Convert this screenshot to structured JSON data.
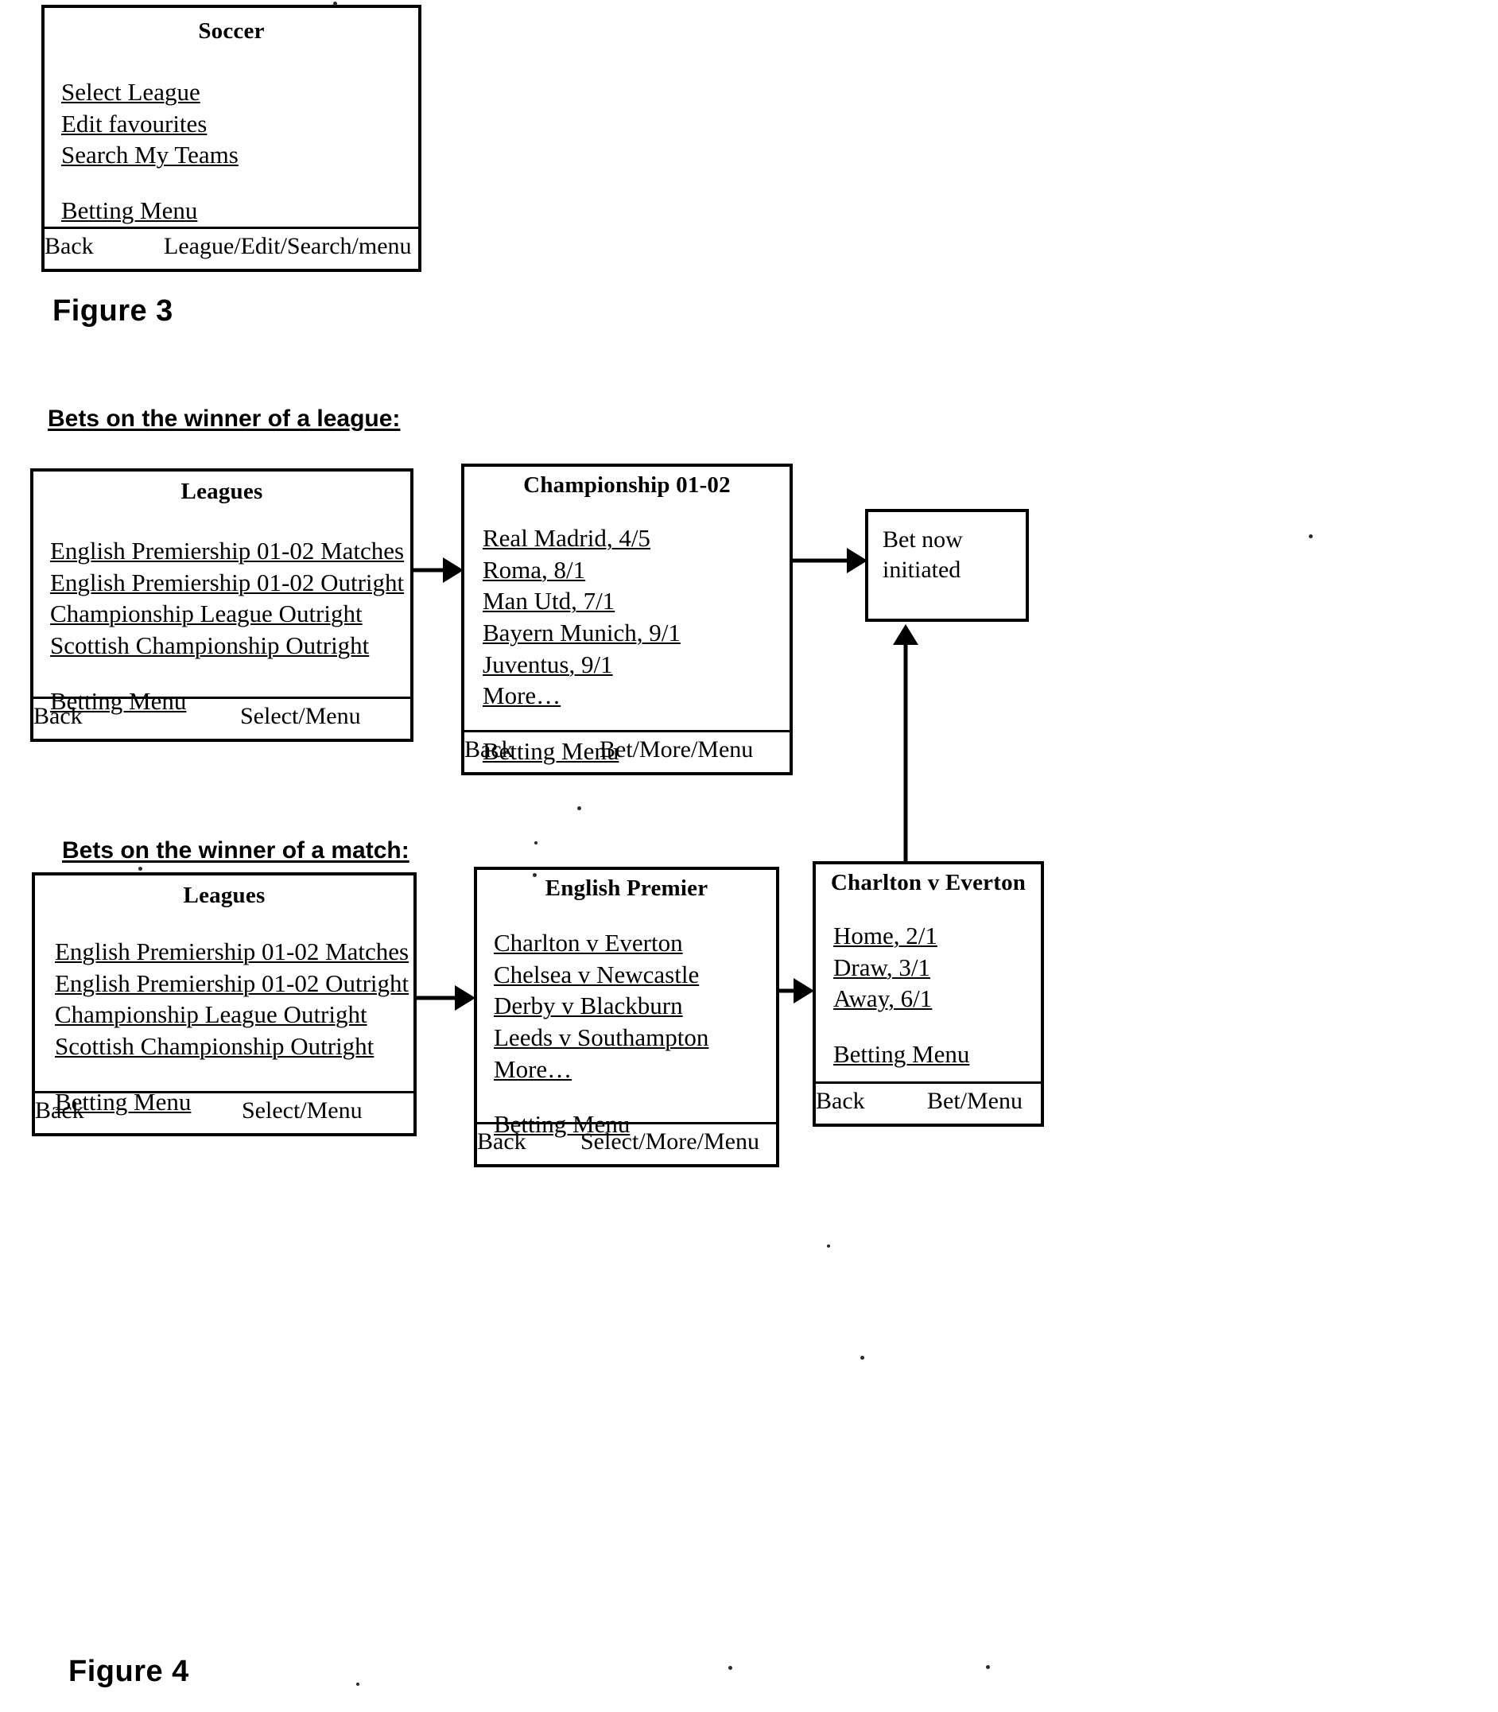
{
  "figure3": {
    "caption": "Figure 3",
    "screen": {
      "title": "Soccer",
      "items": [
        "Select League",
        "Edit favourites",
        "Search My Teams"
      ],
      "secondary": [
        "Betting Menu"
      ],
      "softkeys": {
        "left": "Back",
        "right": "League/Edit/Search/menu"
      }
    }
  },
  "figure4": {
    "caption": "Figure 4",
    "section_league": {
      "heading": "Bets on the winner of a league:",
      "leagues_screen": {
        "title": "Leagues",
        "items": [
          "English Premiership 01-02 Matches",
          "English Premiership 01-02 Outright",
          "Championship League Outright",
          "Scottish Championship Outright"
        ],
        "secondary": [
          "Betting Menu"
        ],
        "softkeys": {
          "left": "Back",
          "right": "Select/Menu"
        }
      },
      "championship_screen": {
        "title": "Championship 01-02",
        "items": [
          "Real Madrid, 4/5",
          "Roma, 8/1",
          "Man Utd, 7/1",
          "Bayern Munich, 9/1",
          "Juventus, 9/1",
          "More…"
        ],
        "secondary": [
          "Betting Menu"
        ],
        "softkeys": {
          "left": "Back",
          "right": "Bet/More/Menu"
        }
      }
    },
    "bet_now_screen": {
      "line1": "Bet now",
      "line2": "initiated"
    },
    "section_match": {
      "heading": "Bets on the winner of a match:",
      "leagues_screen": {
        "title": "Leagues",
        "items": [
          "English Premiership 01-02 Matches",
          "English Premiership 01-02 Outright",
          "Championship League Outright",
          "Scottish Championship Outright"
        ],
        "secondary": [
          "Betting Menu"
        ],
        "softkeys": {
          "left": "Back",
          "right": "Select/Menu"
        }
      },
      "english_premier_screen": {
        "title": "English Premier",
        "items": [
          "Charlton v Everton",
          "Chelsea v Newcastle",
          "Derby v Blackburn",
          "Leeds v Southampton",
          "More…"
        ],
        "secondary": [
          "Betting Menu"
        ],
        "softkeys": {
          "left": "Back",
          "right": "Select/More/Menu"
        }
      },
      "match_screen": {
        "title": "Charlton v Everton",
        "items": [
          "Home, 2/1",
          "Draw, 3/1",
          "Away, 6/1"
        ],
        "secondary": [
          "Betting Menu"
        ],
        "softkeys": {
          "left": "Back",
          "right": "Bet/Menu"
        }
      }
    }
  },
  "colors": {
    "ink": "#000000",
    "paper": "#ffffff"
  }
}
